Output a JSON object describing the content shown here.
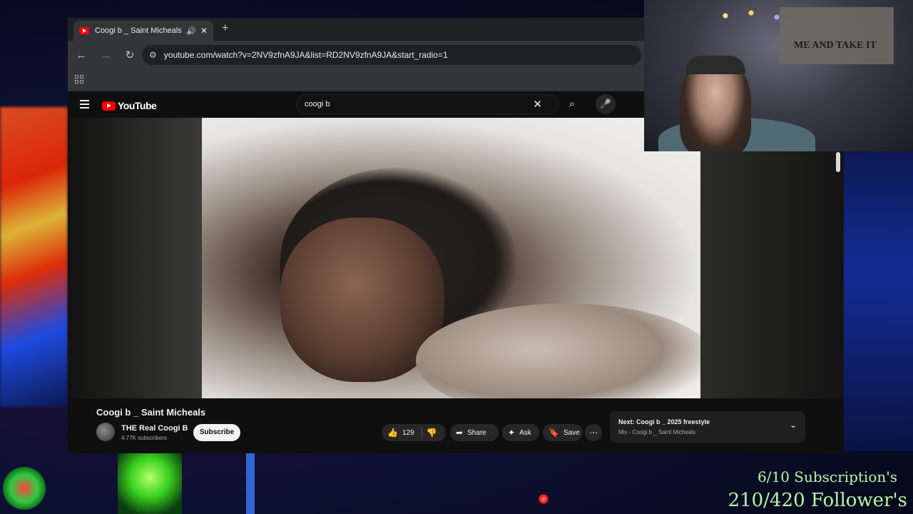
{
  "browser": {
    "tab_title": "Coogi b _ Saint Micheals - Y",
    "new_tab_label": "+",
    "url": "youtube.com/watch?v=2NV9zfnA9JA&list=RD2NV9zfnA9JA&start_radio=1"
  },
  "youtube": {
    "logo_text": "YouTube",
    "search_query": "coogi b",
    "video": {
      "title": "Coogi b _ Saint Micheals",
      "channel": "THE Real Coogi B",
      "subscribers": "4.77K subscribers",
      "subscribe_label": "Subscribe",
      "likes": "129",
      "share_label": "Share",
      "ask_label": "Ask",
      "save_label": "Save"
    },
    "next": {
      "label": "Next:",
      "title": "Coogi b _ 2025 freestyle",
      "subtitle": "Mix - Coogi b _ Saint Micheals"
    }
  },
  "webcam": {
    "flag_text": "ME AND TAKE IT"
  },
  "overlay": {
    "subscription_goal": "6/10 Subscription's",
    "follower_goal": "210/420 Follower's"
  }
}
